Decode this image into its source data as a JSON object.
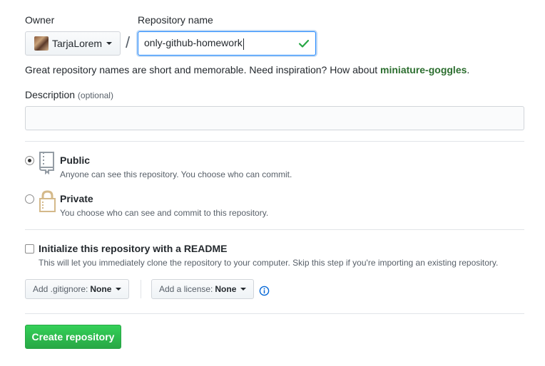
{
  "owner": {
    "label": "Owner",
    "name": "TarjaLorem"
  },
  "repo": {
    "label": "Repository name",
    "value": "only-github-homework",
    "separator": "/"
  },
  "hint": {
    "text": "Great repository names are short and memorable. Need inspiration? How about ",
    "suggestion": "miniature-goggles",
    "end": "."
  },
  "description": {
    "label": "Description",
    "optional": "(optional)",
    "value": ""
  },
  "visibility": {
    "public": {
      "title": "Public",
      "note": "Anyone can see this repository. You choose who can commit.",
      "selected": true
    },
    "private": {
      "title": "Private",
      "note": "You choose who can see and commit to this repository.",
      "selected": false
    }
  },
  "readme": {
    "title": "Initialize this repository with a README",
    "note": "This will let you immediately clone the repository to your computer. Skip this step if you're importing an existing repository.",
    "checked": false
  },
  "gitignore": {
    "prefix": "Add .gitignore:",
    "value": "None"
  },
  "license": {
    "prefix": "Add a license:",
    "value": "None"
  },
  "create_button": "Create repository",
  "colors": {
    "primary_green": "#28a745",
    "link_green": "#2c6e2f",
    "focus_blue": "#2188ff",
    "check_green": "#28a745",
    "info_blue": "#0366d6"
  },
  "icons": {
    "check": "check-icon",
    "public": "repo-icon",
    "private": "lock-icon",
    "info": "info-icon",
    "caret": "caret-down-icon"
  }
}
